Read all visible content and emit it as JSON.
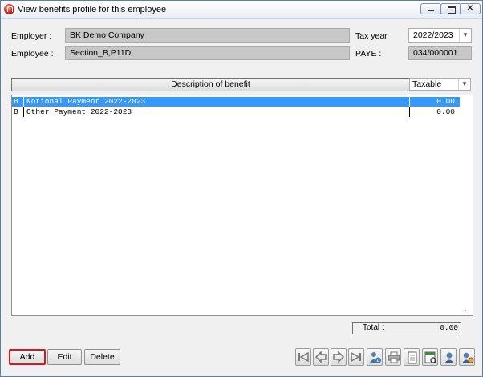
{
  "window": {
    "title": "View benefits profile for this employee"
  },
  "employer": {
    "label": "Employer :",
    "value": "BK Demo Company"
  },
  "employee": {
    "label": "Employee :",
    "value": "Section_B,P11D,"
  },
  "tax_year": {
    "label": "Tax year",
    "value": "2022/2023"
  },
  "paye": {
    "label": "PAYE :",
    "value": "034/000001"
  },
  "list": {
    "header": "Description of benefit",
    "filter": "Taxable",
    "rows": [
      {
        "code": "B",
        "description": "Notional Payment 2022-2023",
        "amount": "0.00",
        "selected": true
      },
      {
        "code": "B",
        "description": "Other Payment 2022-2023",
        "amount": "0.00",
        "selected": false
      }
    ]
  },
  "total": {
    "label": "Total :",
    "value": "0.00"
  },
  "buttons": {
    "add": "Add",
    "edit": "Edit",
    "delete": "Delete"
  },
  "toolbar_icons": [
    "first-record-icon",
    "previous-record-icon",
    "next-record-icon",
    "last-record-icon",
    "person-pound-icon",
    "print-icon",
    "notepad-icon",
    "report-view-icon",
    "user-icon",
    "user-settings-icon"
  ],
  "colors": {
    "selection": "#3399ff",
    "highlight_border": "#e0141e"
  }
}
